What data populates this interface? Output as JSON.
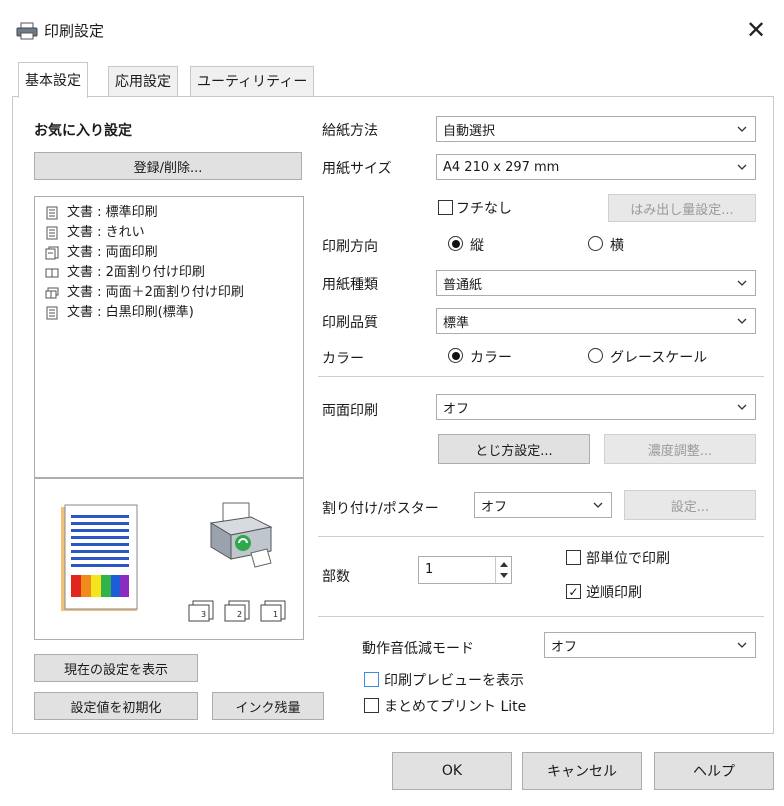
{
  "window": {
    "title": "印刷設定",
    "close_label": "✕"
  },
  "tabs": [
    "基本設定",
    "応用設定",
    "ユーティリティー"
  ],
  "favorites": {
    "heading": "お気に入り設定",
    "register_button": "登録/削除...",
    "items": [
      "文書 : 標準印刷",
      "文書 : きれい",
      "文書 : 両面印刷",
      "文書 : 2面割り付け印刷",
      "文書 : 両面＋2面割り付け印刷",
      "文書 : 白黒印刷(標準)"
    ]
  },
  "left_buttons": {
    "show_current": "現在の設定を表示",
    "reset": "設定値を初期化",
    "ink_levels": "インク残量"
  },
  "settings": {
    "paper_source": {
      "label": "給紙方法",
      "value": "自動選択"
    },
    "paper_size": {
      "label": "用紙サイズ",
      "value": "A4 210 x 297 mm"
    },
    "borderless": {
      "label": "フチなし",
      "checked": false
    },
    "overflow_button": "はみ出し量設定...",
    "orientation": {
      "label": "印刷方向",
      "portrait": "縦",
      "landscape": "横",
      "selected": "portrait"
    },
    "paper_type": {
      "label": "用紙種類",
      "value": "普通紙"
    },
    "quality": {
      "label": "印刷品質",
      "value": "標準"
    },
    "color": {
      "label": "カラー",
      "color_option": "カラー",
      "gray_option": "グレースケール",
      "selected": "color"
    },
    "duplex": {
      "label": "両面印刷",
      "value": "オフ"
    },
    "binding_button": "とじ方設定...",
    "density_button": "濃度調整...",
    "layout": {
      "label": "割り付け/ポスター",
      "value": "オフ",
      "settings_button": "設定..."
    },
    "copies": {
      "label": "部数",
      "value": "1"
    },
    "collate": {
      "label": "部単位で印刷",
      "checked": false
    },
    "reverse": {
      "label": "逆順印刷",
      "checked": true
    },
    "quiet_mode": {
      "label": "動作音低減モード",
      "value": "オフ"
    },
    "print_preview": {
      "label": "印刷プレビューを表示",
      "checked": false
    },
    "print_lite": {
      "label": "まとめてプリント Lite",
      "checked": false
    }
  },
  "footer": {
    "ok": "OK",
    "cancel": "キャンセル",
    "help": "ヘルプ"
  },
  "colors": {
    "accent_blue": "#3a8ee6",
    "button_bg": "#e1e1e1",
    "border": "#adadad"
  },
  "icons": {
    "printer": "printer-icon",
    "chevron": "chevron-down-icon",
    "close": "close-icon"
  }
}
